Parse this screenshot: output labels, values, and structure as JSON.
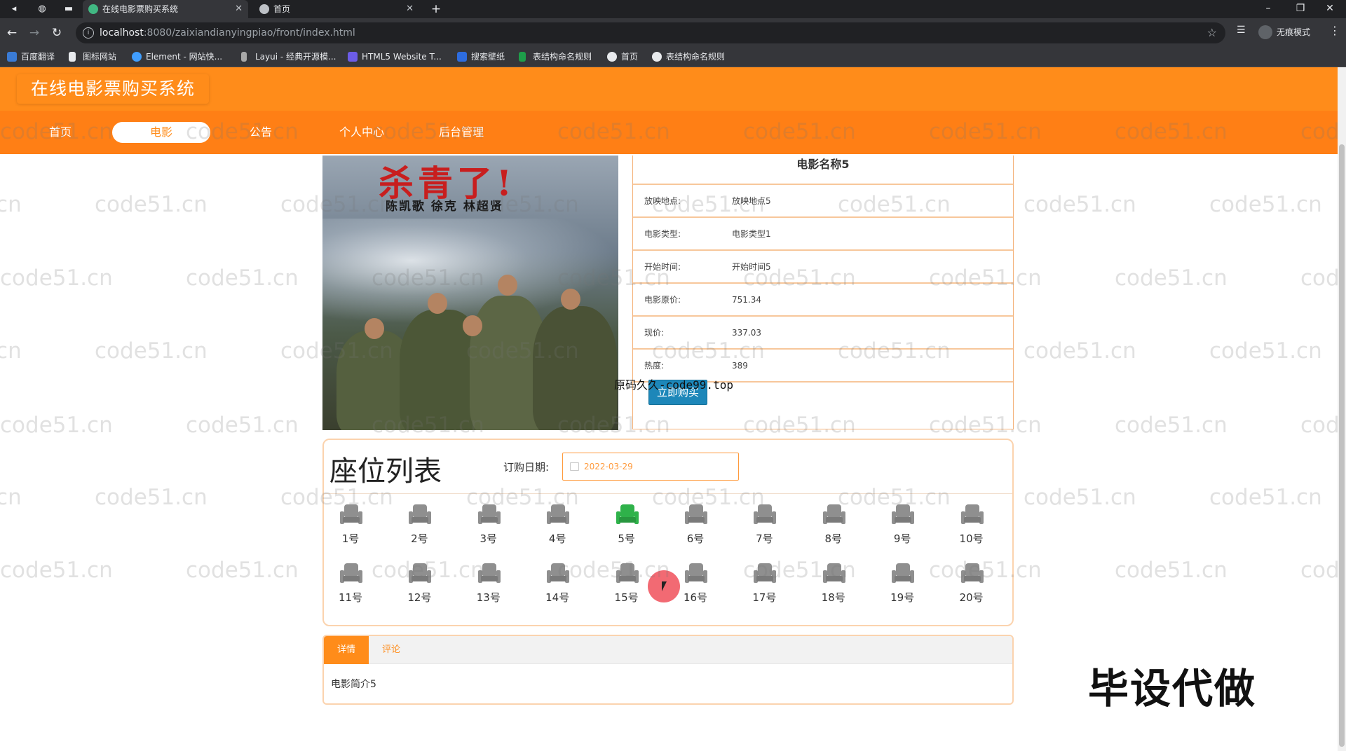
{
  "browser": {
    "tabs": [
      {
        "title": "在线电影票购买系统",
        "favicon_color": "#41b883"
      },
      {
        "title": "首页",
        "favicon_color": "#bdc1c6"
      }
    ],
    "url_host": "localhost",
    "url_rest": ":8080/zaixiandianyingpiao/front/index.html",
    "incognito_label": "无痕模式",
    "bookmarks": [
      "百度翻译",
      "图标网站",
      "Element - 网站快...",
      "Layui - 经典开源模...",
      "HTML5 Website T...",
      "搜索壁纸",
      "表结构命名规则",
      "首页",
      "表结构命名规则"
    ]
  },
  "site": {
    "title": "在线电影票购买系统",
    "nav": [
      "首页",
      "电影",
      "公告",
      "个人中心",
      "后台管理"
    ],
    "active_nav": "电影",
    "accent": "#ff8c1a"
  },
  "poster": {
    "title_art": "杀青了!",
    "names": "陈凯歌  徐克  林超贤"
  },
  "movie": {
    "name": "电影名称5",
    "rows": [
      {
        "label": "放映地点:",
        "value": "放映地点5"
      },
      {
        "label": "电影类型:",
        "value": "电影类型1"
      },
      {
        "label": "开始时间:",
        "value": "开始时间5"
      },
      {
        "label": "电影原价:",
        "value": "751.34"
      },
      {
        "label": "现价:",
        "value": "337.03"
      },
      {
        "label": "热度:",
        "value": "389"
      }
    ],
    "buy_label": "立即购买",
    "overlay_text": "原码久久-code99.top"
  },
  "seats": {
    "title": "座位列表",
    "date_label": "订购日期:",
    "date_value": "2022-03-29",
    "items": [
      "1号",
      "2号",
      "3号",
      "4号",
      "5号",
      "6号",
      "7号",
      "8号",
      "9号",
      "10号",
      "11号",
      "12号",
      "13号",
      "14号",
      "15号",
      "16号",
      "17号",
      "18号",
      "19号",
      "20号"
    ],
    "selected": "5号",
    "selected_color": "#2fb24a",
    "default_color": "#8f8f8f"
  },
  "detail_tabs": {
    "tabs": [
      "详情",
      "评论"
    ],
    "active": "详情",
    "content": "电影简介5"
  },
  "watermark": "code51.cn",
  "promo_text": "毕设代做"
}
